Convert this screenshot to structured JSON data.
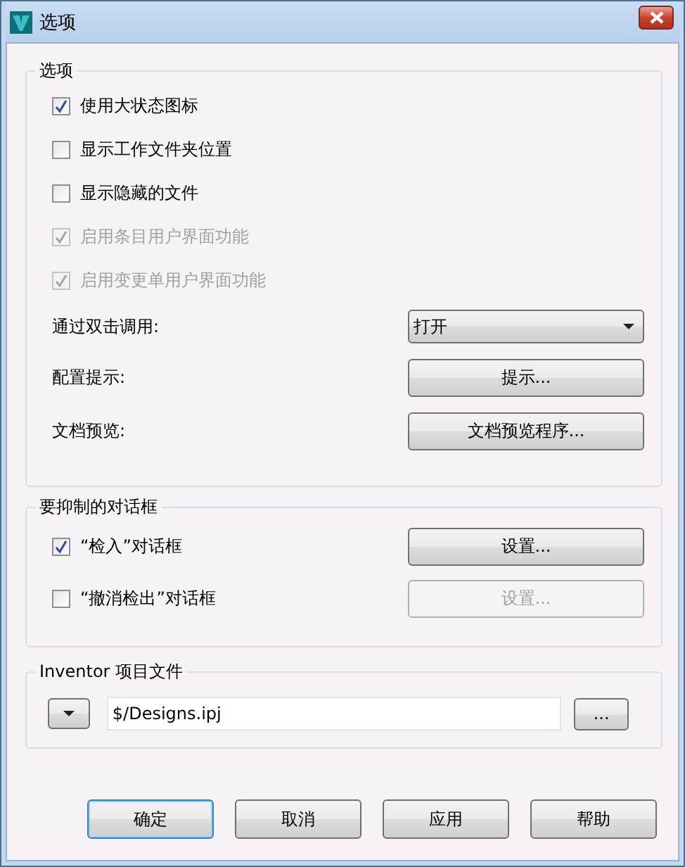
{
  "window": {
    "title": "选项"
  },
  "options": {
    "title": "选项",
    "checkboxes": [
      {
        "label": "使用大状态图标",
        "checked": true,
        "disabled": false
      },
      {
        "label": "显示工作文件夹位置",
        "checked": false,
        "disabled": false
      },
      {
        "label": "显示隐藏的文件",
        "checked": false,
        "disabled": false
      },
      {
        "label": "启用条目用户界面功能",
        "checked": true,
        "disabled": true
      },
      {
        "label": "启用变更单用户界面功能",
        "checked": true,
        "disabled": true
      }
    ],
    "settings": [
      {
        "label": "通过双击调用:",
        "kind": "dropdown",
        "value": "打开"
      },
      {
        "label": "配置提示:",
        "kind": "button",
        "value": "提示..."
      },
      {
        "label": "文档预览:",
        "kind": "button",
        "value": "文档预览程序..."
      }
    ]
  },
  "suppressed_dialogs": {
    "title": "要抑制的对话框",
    "items": [
      {
        "label": "“检入”对话框",
        "checked": true,
        "button": "设置...",
        "disabled": false
      },
      {
        "label": "“撤消检出”对话框",
        "checked": false,
        "button": "设置...",
        "disabled": true
      }
    ]
  },
  "project_file": {
    "title": "Inventor 项目文件",
    "value": "$/Designs.ipj",
    "browse": "..."
  },
  "buttons": [
    {
      "label": "确定",
      "default": true
    },
    {
      "label": "取消",
      "default": false
    },
    {
      "label": "应用",
      "default": false
    },
    {
      "label": "帮助",
      "default": false
    }
  ]
}
